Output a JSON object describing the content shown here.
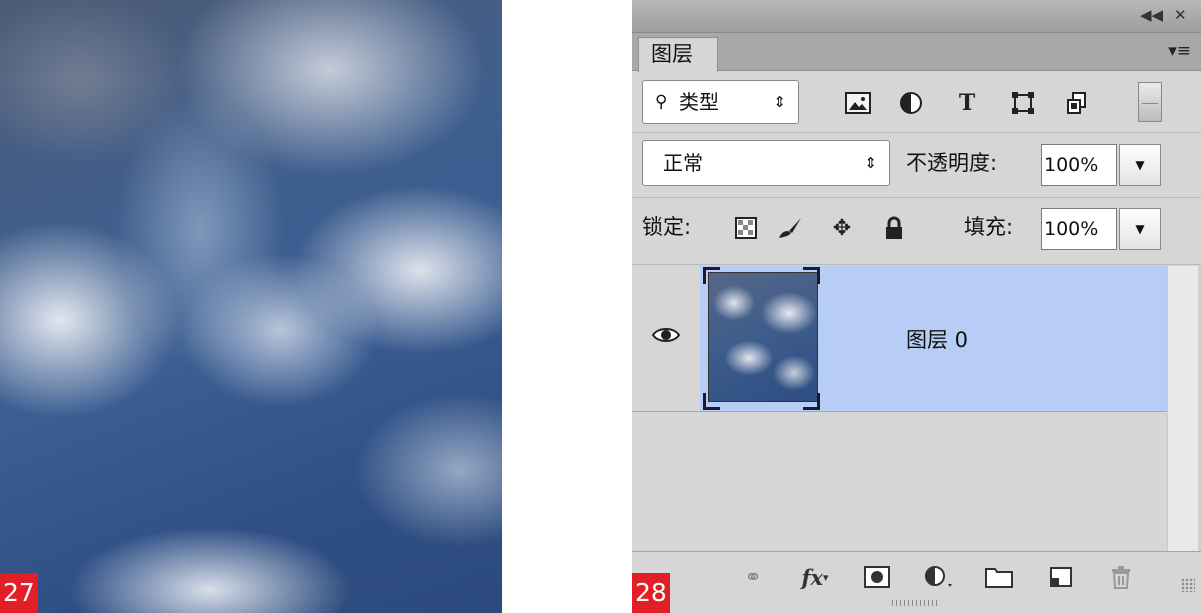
{
  "figures": {
    "left_label": "27",
    "right_label": "28"
  },
  "panel": {
    "tab_label": "图层",
    "filter": {
      "kind_label": "类型",
      "icons": [
        "search-icon",
        "image-filter-icon",
        "adjustment-filter-icon",
        "type-filter-icon",
        "shape-filter-icon",
        "smart-object-filter-icon"
      ]
    },
    "blend_mode": "正常",
    "opacity_label": "不透明度:",
    "opacity_value": "100%",
    "lock_label": "锁定:",
    "fill_label": "填充:",
    "fill_value": "100%",
    "layers": [
      {
        "name": "图层 0",
        "visible": true,
        "selected": true
      }
    ],
    "bottom_icons": [
      "link-layers-icon",
      "fx-icon",
      "layer-mask-icon",
      "adjustment-layer-icon",
      "folder-icon",
      "new-layer-icon",
      "trash-icon"
    ]
  },
  "colors": {
    "badge": "#e21f26",
    "selected_row": "#bfd0f0",
    "panel_bg": "#d6d6d6"
  }
}
